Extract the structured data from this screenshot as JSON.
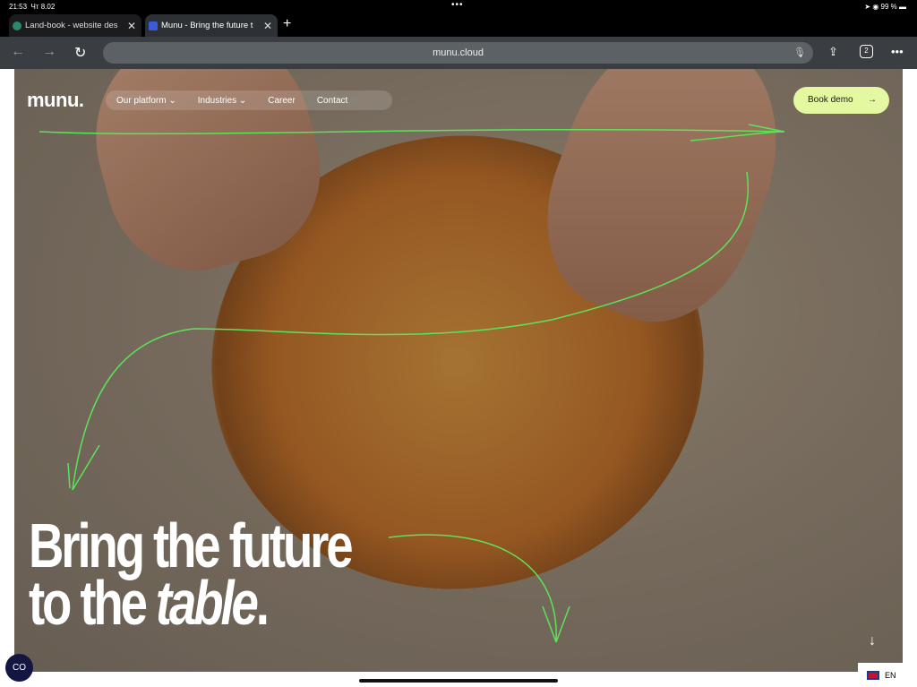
{
  "status": {
    "time": "21:53",
    "date": "Чт 8.02",
    "battery": "99 %"
  },
  "tabs": [
    {
      "title": "Land-book - website des"
    },
    {
      "title": "Munu - Bring the future t"
    }
  ],
  "toolbar": {
    "url": "munu.cloud",
    "tab_count": "2"
  },
  "site": {
    "logo": "munu.",
    "nav": [
      "Our platform ⌄",
      "Industries ⌄",
      "Career",
      "Contact"
    ],
    "cta": "Book demo",
    "headline_line1": "Bring the future",
    "headline_line2_a": "to the ",
    "headline_line2_b": "table",
    "headline_line2_c": "."
  },
  "widgets": {
    "coop_badge": "CO",
    "language": "EN"
  },
  "colors": {
    "cta": "#e3f8a0",
    "annotation": "#5de35a",
    "badge": "#131640"
  }
}
